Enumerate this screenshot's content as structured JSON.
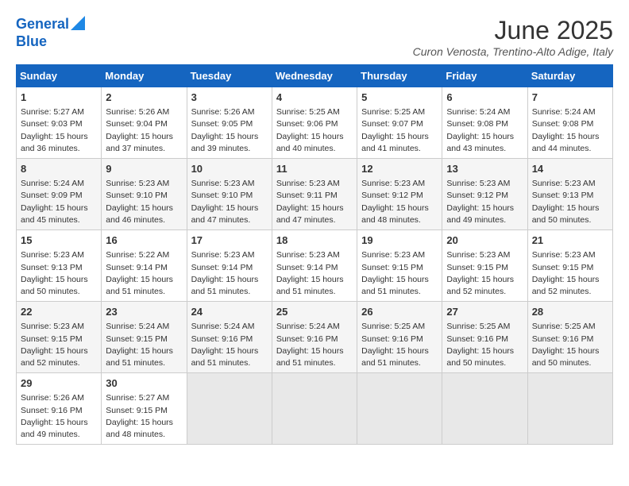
{
  "logo": {
    "line1": "General",
    "line2": "Blue"
  },
  "title": "June 2025",
  "subtitle": "Curon Venosta, Trentino-Alto Adige, Italy",
  "headers": [
    "Sunday",
    "Monday",
    "Tuesday",
    "Wednesday",
    "Thursday",
    "Friday",
    "Saturday"
  ],
  "weeks": [
    [
      {
        "day": "1",
        "info": "Sunrise: 5:27 AM\nSunset: 9:03 PM\nDaylight: 15 hours\nand 36 minutes."
      },
      {
        "day": "2",
        "info": "Sunrise: 5:26 AM\nSunset: 9:04 PM\nDaylight: 15 hours\nand 37 minutes."
      },
      {
        "day": "3",
        "info": "Sunrise: 5:26 AM\nSunset: 9:05 PM\nDaylight: 15 hours\nand 39 minutes."
      },
      {
        "day": "4",
        "info": "Sunrise: 5:25 AM\nSunset: 9:06 PM\nDaylight: 15 hours\nand 40 minutes."
      },
      {
        "day": "5",
        "info": "Sunrise: 5:25 AM\nSunset: 9:07 PM\nDaylight: 15 hours\nand 41 minutes."
      },
      {
        "day": "6",
        "info": "Sunrise: 5:24 AM\nSunset: 9:08 PM\nDaylight: 15 hours\nand 43 minutes."
      },
      {
        "day": "7",
        "info": "Sunrise: 5:24 AM\nSunset: 9:08 PM\nDaylight: 15 hours\nand 44 minutes."
      }
    ],
    [
      {
        "day": "8",
        "info": "Sunrise: 5:24 AM\nSunset: 9:09 PM\nDaylight: 15 hours\nand 45 minutes."
      },
      {
        "day": "9",
        "info": "Sunrise: 5:23 AM\nSunset: 9:10 PM\nDaylight: 15 hours\nand 46 minutes."
      },
      {
        "day": "10",
        "info": "Sunrise: 5:23 AM\nSunset: 9:10 PM\nDaylight: 15 hours\nand 47 minutes."
      },
      {
        "day": "11",
        "info": "Sunrise: 5:23 AM\nSunset: 9:11 PM\nDaylight: 15 hours\nand 47 minutes."
      },
      {
        "day": "12",
        "info": "Sunrise: 5:23 AM\nSunset: 9:12 PM\nDaylight: 15 hours\nand 48 minutes."
      },
      {
        "day": "13",
        "info": "Sunrise: 5:23 AM\nSunset: 9:12 PM\nDaylight: 15 hours\nand 49 minutes."
      },
      {
        "day": "14",
        "info": "Sunrise: 5:23 AM\nSunset: 9:13 PM\nDaylight: 15 hours\nand 50 minutes."
      }
    ],
    [
      {
        "day": "15",
        "info": "Sunrise: 5:23 AM\nSunset: 9:13 PM\nDaylight: 15 hours\nand 50 minutes."
      },
      {
        "day": "16",
        "info": "Sunrise: 5:22 AM\nSunset: 9:14 PM\nDaylight: 15 hours\nand 51 minutes."
      },
      {
        "day": "17",
        "info": "Sunrise: 5:23 AM\nSunset: 9:14 PM\nDaylight: 15 hours\nand 51 minutes."
      },
      {
        "day": "18",
        "info": "Sunrise: 5:23 AM\nSunset: 9:14 PM\nDaylight: 15 hours\nand 51 minutes."
      },
      {
        "day": "19",
        "info": "Sunrise: 5:23 AM\nSunset: 9:15 PM\nDaylight: 15 hours\nand 51 minutes."
      },
      {
        "day": "20",
        "info": "Sunrise: 5:23 AM\nSunset: 9:15 PM\nDaylight: 15 hours\nand 52 minutes."
      },
      {
        "day": "21",
        "info": "Sunrise: 5:23 AM\nSunset: 9:15 PM\nDaylight: 15 hours\nand 52 minutes."
      }
    ],
    [
      {
        "day": "22",
        "info": "Sunrise: 5:23 AM\nSunset: 9:15 PM\nDaylight: 15 hours\nand 52 minutes."
      },
      {
        "day": "23",
        "info": "Sunrise: 5:24 AM\nSunset: 9:15 PM\nDaylight: 15 hours\nand 51 minutes."
      },
      {
        "day": "24",
        "info": "Sunrise: 5:24 AM\nSunset: 9:16 PM\nDaylight: 15 hours\nand 51 minutes."
      },
      {
        "day": "25",
        "info": "Sunrise: 5:24 AM\nSunset: 9:16 PM\nDaylight: 15 hours\nand 51 minutes."
      },
      {
        "day": "26",
        "info": "Sunrise: 5:25 AM\nSunset: 9:16 PM\nDaylight: 15 hours\nand 51 minutes."
      },
      {
        "day": "27",
        "info": "Sunrise: 5:25 AM\nSunset: 9:16 PM\nDaylight: 15 hours\nand 50 minutes."
      },
      {
        "day": "28",
        "info": "Sunrise: 5:25 AM\nSunset: 9:16 PM\nDaylight: 15 hours\nand 50 minutes."
      }
    ],
    [
      {
        "day": "29",
        "info": "Sunrise: 5:26 AM\nSunset: 9:16 PM\nDaylight: 15 hours\nand 49 minutes."
      },
      {
        "day": "30",
        "info": "Sunrise: 5:27 AM\nSunset: 9:15 PM\nDaylight: 15 hours\nand 48 minutes."
      },
      {
        "day": "",
        "info": ""
      },
      {
        "day": "",
        "info": ""
      },
      {
        "day": "",
        "info": ""
      },
      {
        "day": "",
        "info": ""
      },
      {
        "day": "",
        "info": ""
      }
    ]
  ]
}
